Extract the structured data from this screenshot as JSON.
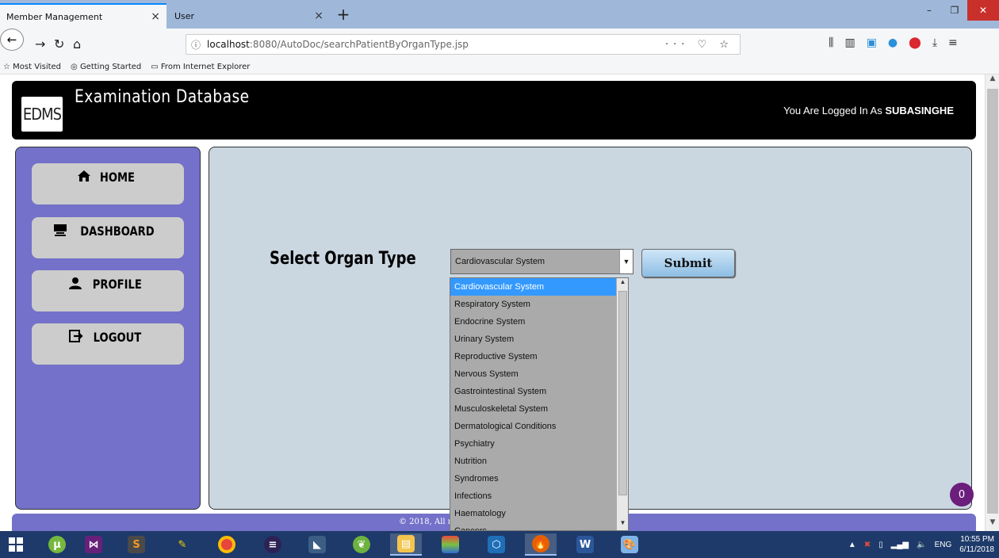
{
  "browser": {
    "tabs": [
      {
        "label": "Member Management",
        "close": "×"
      },
      {
        "label": "User",
        "close": "×"
      }
    ],
    "new_tab": "+",
    "url_host": "localhost",
    "url_path": ":8080/AutoDoc/searchPatientByOrganType.jsp",
    "url_actions": "··· ♡ ☆",
    "bookmarks": [
      "Most Visited",
      "Getting Started",
      "From Internet Explorer"
    ]
  },
  "header": {
    "logo": "EDMS",
    "title": "Examination Database",
    "logged_in_prefix": "You Are Logged In As ",
    "username": "SUBASINGHE"
  },
  "sidebar": {
    "items": [
      {
        "label": "HOME",
        "icon": "home-icon"
      },
      {
        "label": "DASHBOARD",
        "icon": "dashboard-icon"
      },
      {
        "label": "PROFILE",
        "icon": "user-icon"
      },
      {
        "label": "LOGOUT",
        "icon": "logout-icon"
      }
    ]
  },
  "main": {
    "select_label": "Select Organ Type",
    "selected_value": "Cardiovascular System",
    "submit_label": "Submit",
    "options": [
      "Cardiovascular System",
      "Respiratory System",
      "Endocrine System",
      "Urinary System",
      "Reproductive System",
      "Nervous System",
      "Gastrointestinal System",
      "Musculoskeletal System",
      "Dermatological Conditions",
      "Psychiatry",
      "Nutrition",
      "Syndromes",
      "Infections",
      "Haematology",
      "Cancers"
    ]
  },
  "footer": {
    "text": "© 2018, All r"
  },
  "chat_badge": "0",
  "taskbar": {
    "tray_lang": "ENG",
    "time": "10:55 PM",
    "date": "6/11/2018"
  },
  "colors": {
    "sidebar_bg": "#7371c9",
    "content_bg": "#cad6e0",
    "header_bg": "#000000",
    "selected_option": "#3399ff",
    "taskbar_bg": "#1e3a6a"
  }
}
